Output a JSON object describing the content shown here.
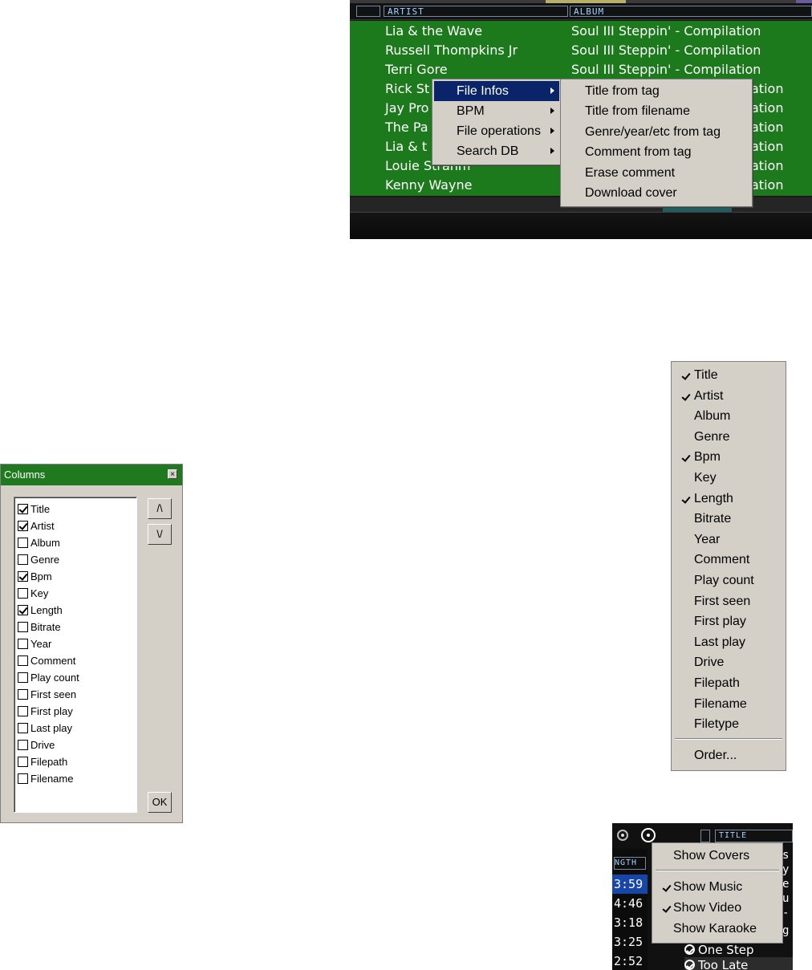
{
  "browser": {
    "headers": [
      "",
      "ARTIST",
      "ALBUM"
    ],
    "rows": [
      {
        "artist": "Lia & the Wave",
        "album": "Soul III Steppin' - Compilation"
      },
      {
        "artist": "Russell Thompkins Jr",
        "album": "Soul III Steppin' - Compilation"
      },
      {
        "artist": "Terri Gore",
        "album": "Soul III Steppin' - Compilation"
      },
      {
        "artist": "Rick St",
        "album": "ation"
      },
      {
        "artist": "Jay Pro",
        "album": "ation"
      },
      {
        "artist": "The Pa",
        "album": "ation"
      },
      {
        "artist": "Lia & t",
        "album": "ation"
      },
      {
        "artist": "Louie Strahm",
        "album": "ation"
      },
      {
        "artist": "Kenny Wayne",
        "album": "ation"
      }
    ],
    "context_menu": [
      "File Infos",
      "BPM",
      "File operations",
      "Search DB"
    ],
    "context_selected": "File Infos",
    "submenu": [
      "Title from tag",
      "Title from filename",
      "Genre/year/etc from tag",
      "Comment from tag",
      "Erase comment",
      "Download cover"
    ]
  },
  "columns_dialog": {
    "title": "Columns",
    "close": "×",
    "items": [
      {
        "label": "Title",
        "checked": true
      },
      {
        "label": "Artist",
        "checked": true
      },
      {
        "label": "Album",
        "checked": false
      },
      {
        "label": "Genre",
        "checked": false
      },
      {
        "label": "Bpm",
        "checked": true
      },
      {
        "label": "Key",
        "checked": false
      },
      {
        "label": "Length",
        "checked": true
      },
      {
        "label": "Bitrate",
        "checked": false
      },
      {
        "label": "Year",
        "checked": false
      },
      {
        "label": "Comment",
        "checked": false
      },
      {
        "label": "Play count",
        "checked": false
      },
      {
        "label": "First seen",
        "checked": false
      },
      {
        "label": "First play",
        "checked": false
      },
      {
        "label": "Last play",
        "checked": false
      },
      {
        "label": "Drive",
        "checked": false
      },
      {
        "label": "Filepath",
        "checked": false
      },
      {
        "label": "Filename",
        "checked": false
      }
    ],
    "up_label": "/\\",
    "down_label": "\\/",
    "ok_label": "OK"
  },
  "column_menu": {
    "items": [
      {
        "label": "Title",
        "checked": true
      },
      {
        "label": "Artist",
        "checked": true
      },
      {
        "label": "Album",
        "checked": false
      },
      {
        "label": "Genre",
        "checked": false
      },
      {
        "label": "Bpm",
        "checked": true
      },
      {
        "label": "Key",
        "checked": false
      },
      {
        "label": "Length",
        "checked": true
      },
      {
        "label": "Bitrate",
        "checked": false
      },
      {
        "label": "Year",
        "checked": false
      },
      {
        "label": "Comment",
        "checked": false
      },
      {
        "label": "Play count",
        "checked": false
      },
      {
        "label": "First seen",
        "checked": false
      },
      {
        "label": "First play",
        "checked": false
      },
      {
        "label": "Last play",
        "checked": false
      },
      {
        "label": "Drive",
        "checked": false
      },
      {
        "label": "Filepath",
        "checked": false
      },
      {
        "label": "Filename",
        "checked": false
      },
      {
        "label": "Filetype",
        "checked": false
      }
    ],
    "order_label": "Order..."
  },
  "snippet": {
    "title_header": "TITLE",
    "length_header": "NGTH",
    "times": [
      "3:59",
      "4:46",
      "3:18",
      "3:25",
      "2:52"
    ],
    "right_letters": [
      "s",
      "y",
      "e",
      "u",
      "-",
      "g"
    ],
    "tracks": [
      "One Step",
      "Too Late"
    ],
    "menu": [
      {
        "label": "Show Covers",
        "checked": false
      },
      {
        "label": "Show Music",
        "checked": true
      },
      {
        "label": "Show Video",
        "checked": true
      },
      {
        "label": "Show Karaoke",
        "checked": false
      }
    ]
  },
  "colors": {
    "list_green": "#1c7a1c",
    "title_green": "#1f7a1f",
    "menu_highlight": "#0a246a",
    "menu_face": "#d4d0c8",
    "time_highlight": "#1846a8"
  }
}
